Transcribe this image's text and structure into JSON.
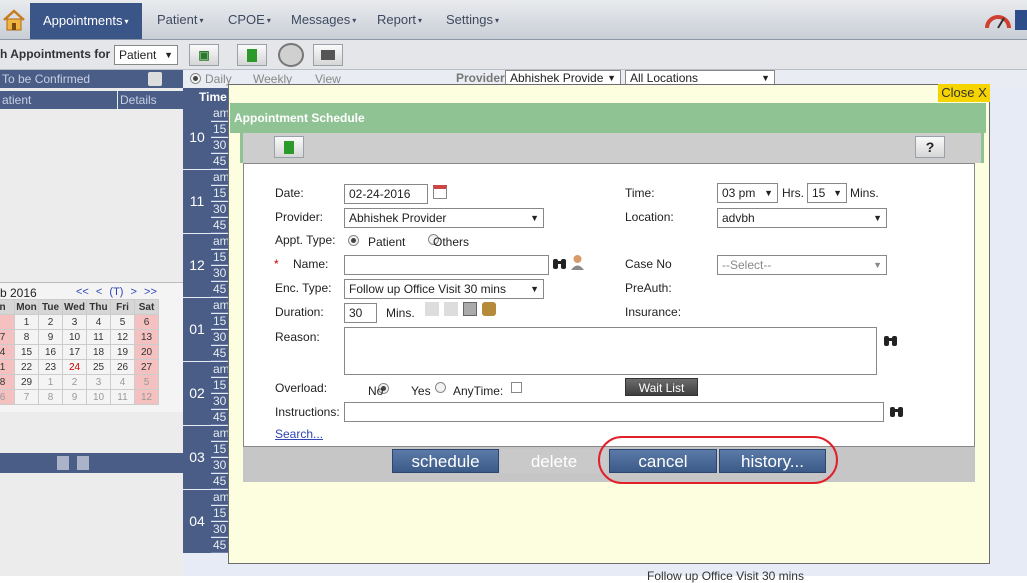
{
  "nav": {
    "items": [
      "Appointments",
      "Patient",
      "CPOE",
      "Messages",
      "Report",
      "Settings"
    ]
  },
  "toolbar": {
    "search_for_label": "h Appointments for",
    "search_for_value": "Patient"
  },
  "view": {
    "daily": "Daily",
    "weekly": "Weekly",
    "view": "View",
    "provider_label": "Provider",
    "provider_value": "Abhishek Provide",
    "location_value": "All Locations"
  },
  "left_panel": {
    "to_confirm": "To be Confirmed",
    "col_patient": "atient",
    "col_details": "Details",
    "month_title": "b 2016",
    "month_nav": [
      "<<",
      "<",
      "(T)",
      ">",
      ">>"
    ],
    "weekdays": [
      "n",
      "Mon",
      "Tue",
      "Wed",
      "Thu",
      "Fri",
      "Sat"
    ],
    "weeks": [
      [
        "1",
        "2",
        "3",
        "4",
        "5",
        "6"
      ],
      [
        "7",
        "8",
        "9",
        "10",
        "11",
        "12",
        "13"
      ],
      [
        "4",
        "15",
        "16",
        "17",
        "18",
        "19",
        "20"
      ],
      [
        "1",
        "22",
        "23",
        "24",
        "25",
        "26",
        "27"
      ],
      [
        "8",
        "29",
        "1",
        "2",
        "3",
        "4",
        "5"
      ],
      [
        "6",
        "7",
        "8",
        "9",
        "10",
        "11",
        "12"
      ]
    ]
  },
  "grid": {
    "time_header": "Time",
    "hours": [
      "10",
      "11",
      "12",
      "01",
      "02",
      "03",
      "04"
    ],
    "mins": [
      "am",
      "15",
      "30",
      "45"
    ],
    "bottom_text": "Follow up Office Visit 30 mins"
  },
  "modal": {
    "close": "Close X",
    "title": "Appointment Schedule",
    "help": "?"
  },
  "form": {
    "date_label": "Date:",
    "date_value": "02-24-2016",
    "time_label": "Time:",
    "time_hour": "03 pm",
    "time_hrs": "Hrs.",
    "time_min": "15",
    "time_mins": "Mins.",
    "provider_label": "Provider:",
    "provider_value": "Abhishek Provider",
    "location_label": "Location:",
    "location_value": "advbh",
    "appt_type_label": "Appt. Type:",
    "appt_patient": "Patient",
    "appt_others": "Others",
    "required_mark": "*",
    "name_label": "Name:",
    "name_value": "",
    "case_label": "Case No",
    "case_value": "--Select--",
    "enc_label": "Enc. Type:",
    "enc_value": "Follow up Office Visit 30 mins",
    "preauth_label": "PreAuth:",
    "duration_label": "Duration:",
    "duration_value": "30",
    "duration_unit": "Mins.",
    "insurance_label": "Insurance:",
    "reason_label": "Reason:",
    "reason_value": "",
    "overload_label": "Overload:",
    "overload_no": "No",
    "overload_yes": "Yes",
    "anytime_label": "AnyTime:",
    "waitlist": "Wait List",
    "instructions_label": "Instructions:",
    "instructions_value": "",
    "search_link": "Search..."
  },
  "buttons": {
    "schedule": "schedule",
    "delete": "delete",
    "cancel": "cancel",
    "history": "history..."
  }
}
